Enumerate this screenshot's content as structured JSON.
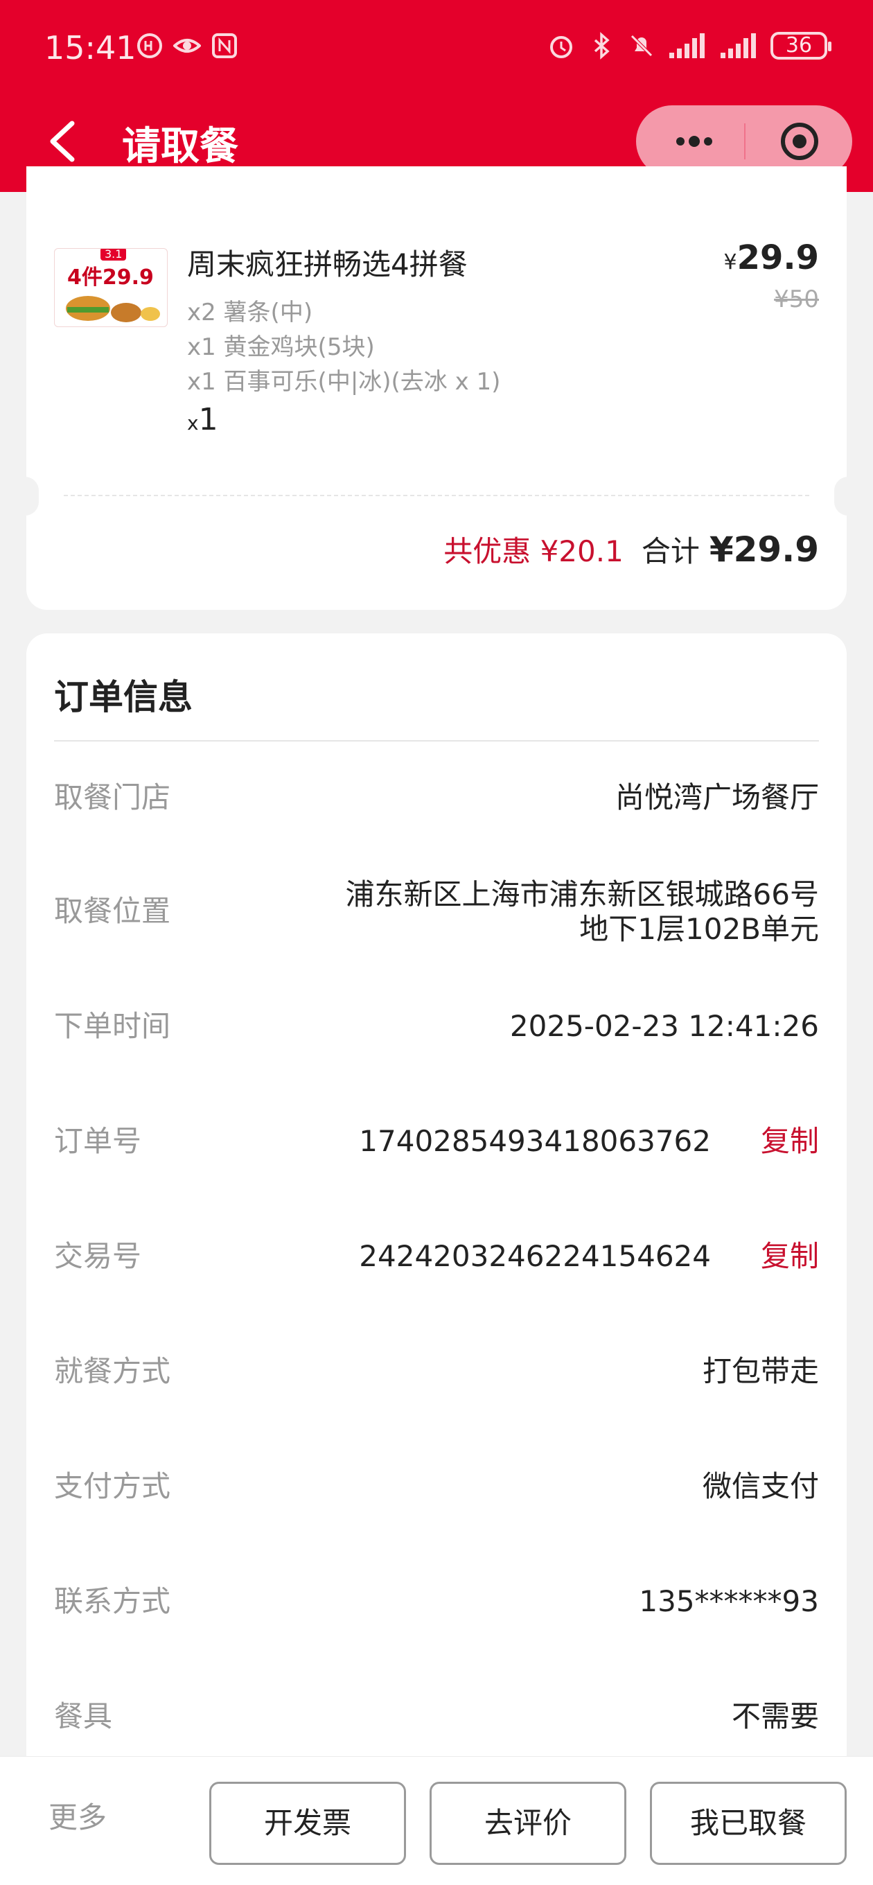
{
  "status_bar": {
    "time": "15:41",
    "battery": "36"
  },
  "nav": {
    "title": "请取餐"
  },
  "product": {
    "name": "周末疯狂拼畅选4拼餐",
    "thumb_label": "4件29.9",
    "thumb_tag": "3.1",
    "price_currency": "¥",
    "price": "29.9",
    "original_price": "¥50",
    "items": [
      "x2 薯条(中)",
      "x1 黄金鸡块(5块)",
      "x1 百事可乐(中|冰)(去冰 x 1)"
    ],
    "qty_prefix": "x",
    "qty": "1"
  },
  "summary": {
    "discount": "共优惠 ¥20.1",
    "total_label": "合计",
    "total_value": "¥29.9"
  },
  "order_info": {
    "title": "订单信息",
    "rows": [
      {
        "label": "取餐门店",
        "value": "尚悦湾广场餐厅"
      },
      {
        "label": "取餐位置",
        "value_line1": "浦东新区上海市浦东新区银城路66号",
        "value_line2": "地下1层102B单元"
      },
      {
        "label": "下单时间",
        "value": "2025-02-23 12:41:26"
      },
      {
        "label": "订单号",
        "value": "1740285493418063762",
        "copy": "复制"
      },
      {
        "label": "交易号",
        "value": "2424203246224154624",
        "copy": "复制"
      },
      {
        "label": "就餐方式",
        "value": "打包带走"
      },
      {
        "label": "支付方式",
        "value": "微信支付"
      },
      {
        "label": "联系方式",
        "value": "135******93"
      },
      {
        "label": "餐具",
        "value": "不需要"
      }
    ]
  },
  "bottom_bar": {
    "more": "更多",
    "invoice": "开发票",
    "review": "去评价",
    "picked_up": "我已取餐"
  },
  "colors": {
    "brand": "#e4002b",
    "discount": "#c8102e",
    "page_bg": "#f2f2f2"
  }
}
